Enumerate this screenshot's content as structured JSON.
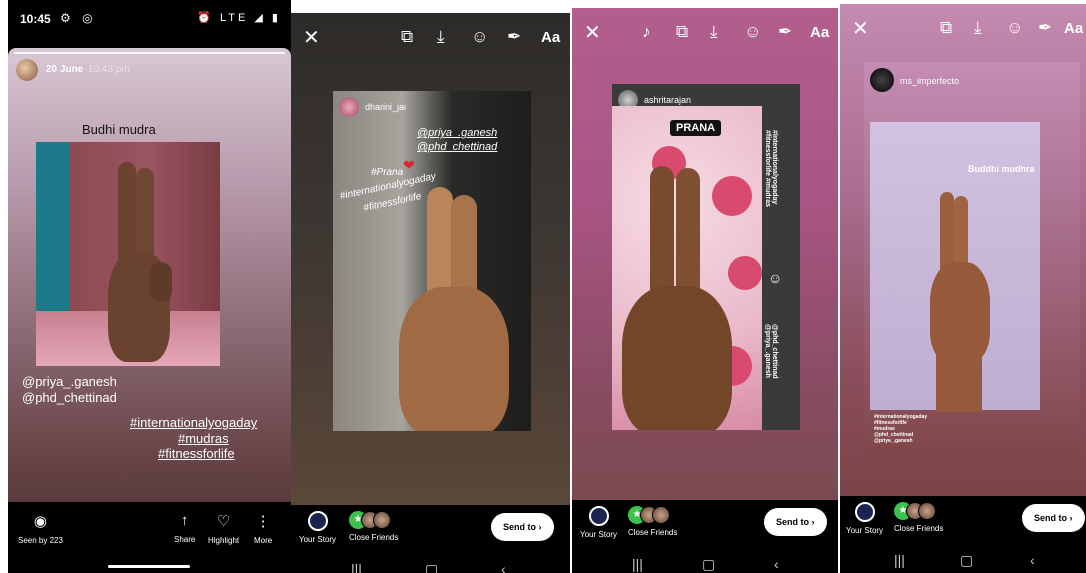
{
  "status_bar": {
    "time": "10:45",
    "left_icons": "⚙ ◎",
    "right_icons": "⏰ LTE ◢ ▮"
  },
  "panel1": {
    "date": "20 June",
    "time": "10:43 pm",
    "title": "Budhi mudra",
    "mentions": [
      "@priya_.ganesh",
      "@phd_chettinad"
    ],
    "hashtags": [
      "#internationalyogaday",
      "#mudras",
      "#fitnessforlife"
    ],
    "bottom": {
      "seen": "Seen by 223",
      "share": "Share",
      "highlight": "Highlight",
      "more": "More"
    }
  },
  "panel2": {
    "username": "dharini_jai",
    "mentions": [
      "@priya_.ganesh",
      "@phd_chettinad"
    ],
    "hashtags": [
      "#Prana",
      "#internationalyogaday",
      "#fitnessforlife"
    ]
  },
  "panel3": {
    "username": "ashritarajan",
    "label": "PRANA",
    "hashtags_vertical": "#internationalyogaday #fitnessforlife #mudras",
    "mentions_vertical": "@phd_chettinad @priya_.ganesh"
  },
  "panel4": {
    "username": "ms_imperfecto",
    "title": "Buddhi mudhra",
    "small_tags": [
      "#internationalyogaday",
      "#fitnessforlife",
      "#mudras",
      "@phd_chettinad",
      "@priya_.ganesh"
    ]
  },
  "editor": {
    "your_story": "Your Story",
    "close_friends": "Close Friends",
    "send_to": "Send to",
    "aa": "Aa"
  },
  "icons": {
    "close": "✕",
    "link": "⧉",
    "download": "⤓",
    "sticker": "☺",
    "draw": "✒",
    "sound": "♪",
    "eye": "◉",
    "share": "↑",
    "highlight": "♡",
    "more": "⋮",
    "chevron": "›",
    "recent": "|||",
    "home": "▢",
    "back": "‹"
  },
  "colors": {
    "green": "#3cc24c",
    "send_bg": "#ffffff"
  }
}
